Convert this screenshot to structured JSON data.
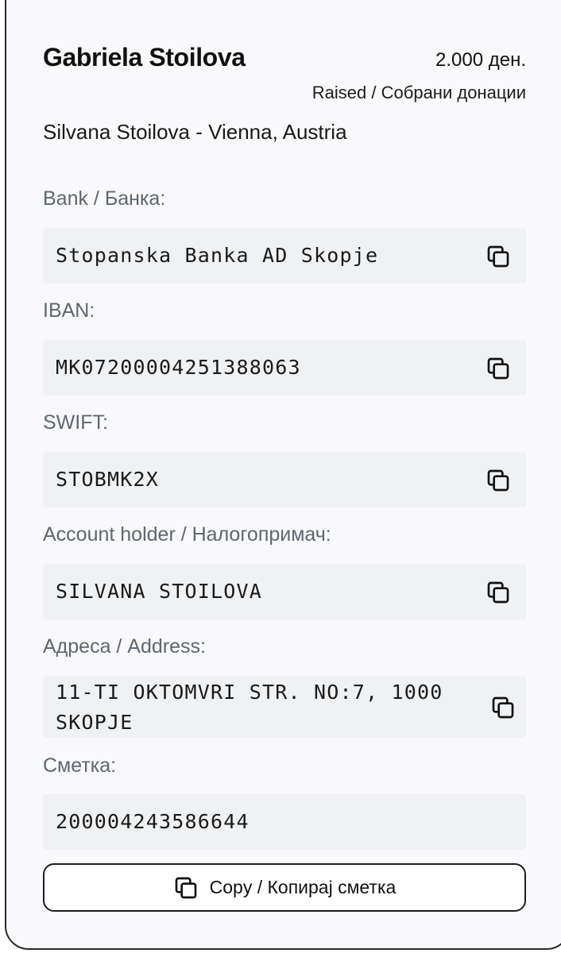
{
  "header": {
    "name": "Gabriela Stoilova",
    "amount": "2.000 ден.",
    "raised_label": "Raised / Собрани донации",
    "subtitle": "Silvana Stoilova - Vienna, Austria"
  },
  "fields": {
    "bank": {
      "label": "Bank / Банка:",
      "value": "Stopanska Banka AD Skopje",
      "icon": "copy-icon"
    },
    "iban": {
      "label": "IBAN:",
      "value": "MK07200004251388063",
      "icon": "copy-icon"
    },
    "swift": {
      "label": "SWIFT:",
      "value": "STOBMK2X",
      "icon": "copy-icon"
    },
    "holder": {
      "label": "Account holder / Налогопримач:",
      "value": "SILVANA STOILOVA",
      "icon": "copy-icon"
    },
    "address": {
      "label": "Адреса / Address:",
      "value_line1": "11-TI OKTOMVRI STR. NO:7, 1000",
      "value_line2": "SKOPJE",
      "icon": "copy-icon"
    },
    "account": {
      "label": "Сметка:",
      "value": "200004243586644"
    }
  },
  "copy_button": {
    "label": "Copy / Копирај сметка",
    "icon": "copy-icon"
  }
}
